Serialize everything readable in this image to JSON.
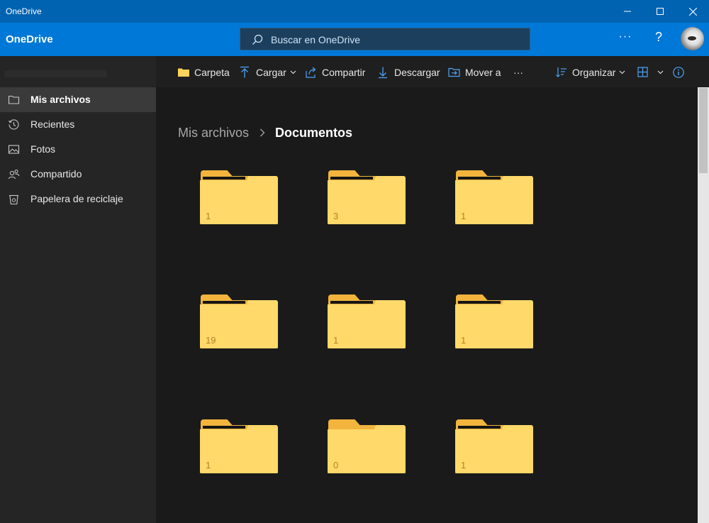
{
  "window": {
    "title": "OneDrive"
  },
  "header": {
    "brand": "OneDrive",
    "search_placeholder": "Buscar en OneDrive",
    "more_label": "···",
    "help_label": "?"
  },
  "sidebar": {
    "items": [
      {
        "label": "Mis archivos",
        "icon": "folder-icon",
        "active": true
      },
      {
        "label": "Recientes",
        "icon": "history-icon",
        "active": false
      },
      {
        "label": "Fotos",
        "icon": "photo-icon",
        "active": false
      },
      {
        "label": "Compartido",
        "icon": "people-icon",
        "active": false
      },
      {
        "label": "Papelera de reciclaje",
        "icon": "recycle-bin-icon",
        "active": false
      }
    ]
  },
  "commandbar": {
    "new_folder": "Carpeta",
    "upload": "Cargar",
    "share": "Compartir",
    "download": "Descargar",
    "move_to": "Mover a",
    "more": "···",
    "sort": "Organizar"
  },
  "breadcrumb": {
    "root": "Mis archivos",
    "current": "Documentos"
  },
  "folders": [
    {
      "count": "1"
    },
    {
      "count": "3"
    },
    {
      "count": "1"
    },
    {
      "count": "19"
    },
    {
      "count": "1"
    },
    {
      "count": "1"
    },
    {
      "count": "1"
    },
    {
      "count": "0"
    },
    {
      "count": "1"
    }
  ],
  "colors": {
    "titlebar": "#0063b1",
    "header": "#0078d7",
    "sidebar": "#252525",
    "content": "#1a1a1a",
    "folder": "#ffd96a",
    "accent": "#4fa3f7"
  }
}
